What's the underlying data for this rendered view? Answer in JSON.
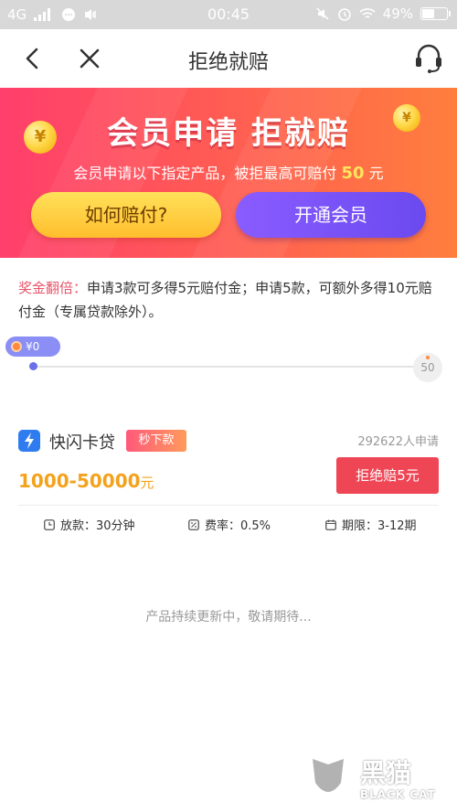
{
  "status_bar": {
    "network": "4G",
    "time": "00:45",
    "battery": "49%"
  },
  "nav": {
    "title": "拒绝就赔"
  },
  "banner": {
    "title": "会员申请  拒就赔",
    "subtitle_pre": "会员申请以下指定产品，被拒最高可赔付",
    "subtitle_amount": "50",
    "subtitle_unit": "元",
    "coin_symbol": "¥",
    "btn_how": "如何赔付?",
    "btn_member": "开通会员",
    "colors": {
      "gradient_start": "#ff3f6c",
      "gradient_end": "#ff7e3d",
      "member_button": "#6a4af0",
      "how_button": "#ffc83a"
    }
  },
  "bonus": {
    "label": "奖金翻倍：",
    "text": "申请3款可多得5元赔付金；申请5款，可额外多得10元赔付金（专属贷款除外）。"
  },
  "progress": {
    "current_label": "¥0",
    "max_label": "50",
    "value": 0,
    "max": 50
  },
  "product": {
    "name": "快闪卡贷",
    "tag": "秒下款",
    "applicants": "292622人申请",
    "amount": "1000-50000",
    "amount_unit": "元",
    "button": "拒绝赔5元",
    "meta": [
      {
        "icon": "clock-icon",
        "text": "放款：30分钟"
      },
      {
        "icon": "percent-icon",
        "text": "费率：0.5%"
      },
      {
        "icon": "calendar-icon",
        "text": "期限：3-12期"
      }
    ]
  },
  "footer_note": "产品持续更新中，敬请期待...",
  "watermark": {
    "cn": "黑猫",
    "en": "BLACK CAT"
  }
}
